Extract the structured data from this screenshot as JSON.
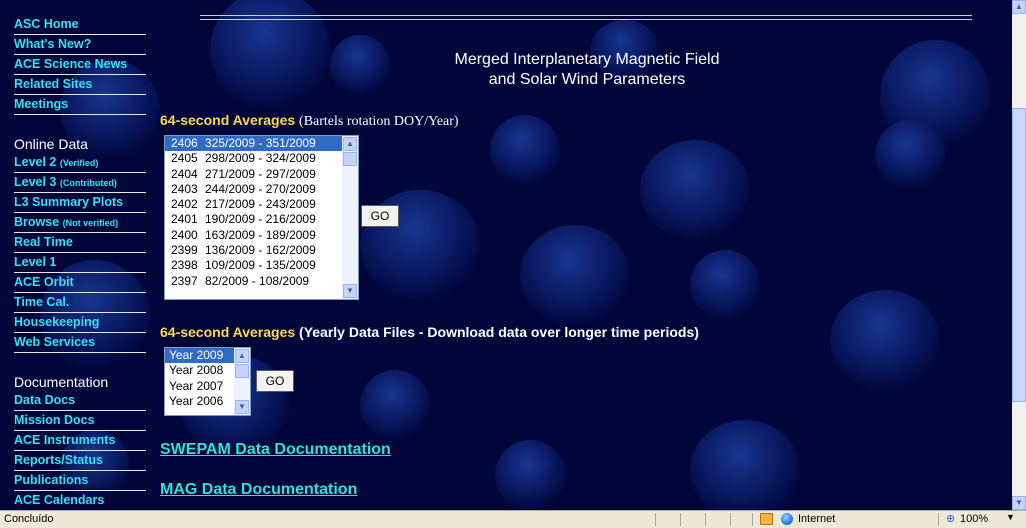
{
  "nav": {
    "items_top": [
      {
        "label": "ASC Home",
        "suffix": ""
      },
      {
        "label": "What's New?",
        "suffix": ""
      },
      {
        "label": "ACE Science News",
        "suffix": ""
      },
      {
        "label": "Related Sites",
        "suffix": ""
      },
      {
        "label": "Meetings",
        "suffix": ""
      }
    ],
    "online_heading": "Online Data",
    "items_online": [
      {
        "label": "Level 2 ",
        "suffix": "(Verified)"
      },
      {
        "label": "Level 3 ",
        "suffix": "(Contributed)"
      },
      {
        "label": "L3 Summary Plots",
        "suffix": ""
      },
      {
        "label": "Browse ",
        "suffix": "(Not verified)"
      },
      {
        "label": "Real Time",
        "suffix": ""
      },
      {
        "label": "Level 1",
        "suffix": ""
      },
      {
        "label": "ACE Orbit",
        "suffix": ""
      },
      {
        "label": "Time Cal.",
        "suffix": ""
      },
      {
        "label": "Housekeeping",
        "suffix": ""
      },
      {
        "label": "Web Services",
        "suffix": ""
      }
    ],
    "doc_heading": "Documentation",
    "items_docs": [
      {
        "label": "Data Docs",
        "suffix": ""
      },
      {
        "label": "Mission Docs",
        "suffix": ""
      },
      {
        "label": "ACE Instruments",
        "suffix": ""
      },
      {
        "label": "Reports/Status",
        "suffix": ""
      },
      {
        "label": "Publications",
        "suffix": ""
      },
      {
        "label": "ACE Calendars",
        "suffix": ""
      }
    ]
  },
  "main": {
    "title_line1": "Merged Interplanetary Magnetic Field",
    "title_line2": "and Solar Wind Parameters",
    "section1": {
      "heading": "64-second Averages",
      "note": "(Bartels rotation   DOY/Year)",
      "rotations": [
        {
          "num": "2406",
          "range": "325/2009 - 351/2009",
          "selected": true
        },
        {
          "num": "2405",
          "range": "298/2009 - 324/2009",
          "selected": false
        },
        {
          "num": "2404",
          "range": "271/2009 - 297/2009",
          "selected": false
        },
        {
          "num": "2403",
          "range": "244/2009 - 270/2009",
          "selected": false
        },
        {
          "num": "2402",
          "range": "217/2009 - 243/2009",
          "selected": false
        },
        {
          "num": "2401",
          "range": "190/2009 - 216/2009",
          "selected": false
        },
        {
          "num": "2400",
          "range": "163/2009 - 189/2009",
          "selected": false
        },
        {
          "num": "2399",
          "range": "136/2009 - 162/2009",
          "selected": false
        },
        {
          "num": "2398",
          "range": "109/2009 - 135/2009",
          "selected": false
        },
        {
          "num": "2397",
          "range": "82/2009 - 108/2009",
          "selected": false
        }
      ],
      "go_label": "GO"
    },
    "section2": {
      "heading": "64-second Averages",
      "note": "(Yearly Data Files - Download data over longer time periods)",
      "years": [
        {
          "label": "Year 2009",
          "selected": true
        },
        {
          "label": "Year 2008",
          "selected": false
        },
        {
          "label": "Year 2007",
          "selected": false
        },
        {
          "label": "Year 2006",
          "selected": false
        }
      ],
      "go_label": "GO"
    },
    "swepam_link": "SWEPAM Data Documentation",
    "mag_link": "MAG Data Documentation"
  },
  "statusbar": {
    "status": "Concluído",
    "zone": "Internet",
    "zoom": "100%"
  },
  "colors": {
    "background": "#00063a",
    "nav_link": "#36e0f0",
    "heading_gold": "#ffd84a",
    "doc_link": "#36e0d0",
    "selection": "#316ac5"
  },
  "icons": {
    "scroll_up": "chevron-up-icon",
    "scroll_down": "chevron-down-icon",
    "zone": "internet-globe-icon",
    "zoom": "zoom-icon"
  }
}
